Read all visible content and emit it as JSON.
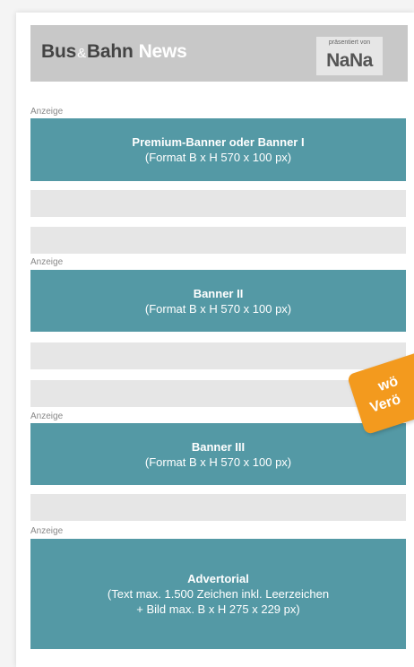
{
  "header": {
    "brand_bus": "Bus",
    "brand_amp": "&",
    "brand_bahn": "Bahn",
    "brand_news": "News",
    "badge_label": "präsentiert von",
    "badge_logo": "NaNa"
  },
  "ad_label": "Anzeige",
  "banners": [
    {
      "title": "Premium-Banner oder Banner I",
      "line1": "(Format B x H 570 x 100 px)"
    },
    {
      "title": "Banner II",
      "line1": "(Format B x H 570 x 100 px)"
    },
    {
      "title": "Banner III",
      "line1": "(Format B x H 570 x 100 px)"
    },
    {
      "title": "Advertorial",
      "line1": "(Text max. 1.500 Zeichen inkl. Leerzeichen",
      "line2": "+ Bild max. B x H 275 x 229 px)"
    }
  ],
  "sticker": {
    "line1": "wö",
    "line2": "Verö"
  },
  "colors": {
    "banner": "#5499a5",
    "header": "#c8c8c8",
    "placeholder": "#e6e6e6",
    "sticker": "#f39a1e"
  }
}
